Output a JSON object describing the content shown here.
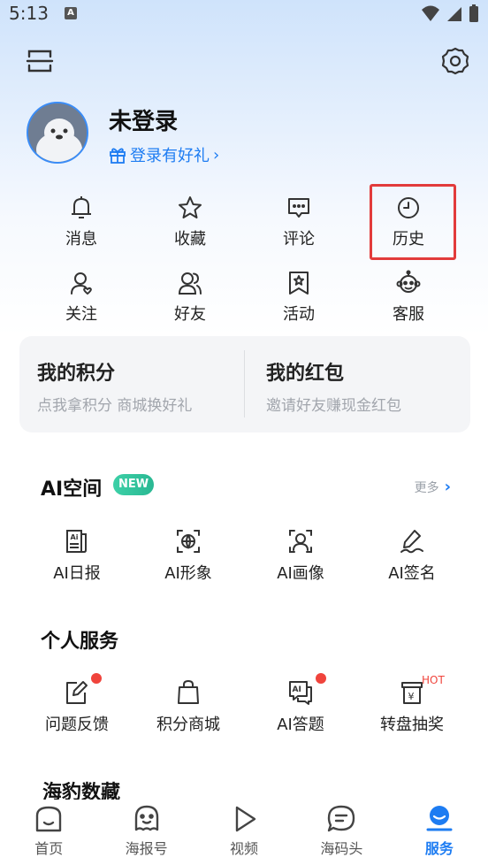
{
  "status_bar": {
    "time": "5:13",
    "a_icon": "A"
  },
  "profile": {
    "username": "未登录",
    "login_gift": "登录有好礼"
  },
  "quick_grid": [
    {
      "label": "消息",
      "icon": "bell-icon"
    },
    {
      "label": "收藏",
      "icon": "star-icon"
    },
    {
      "label": "评论",
      "icon": "comment-icon"
    },
    {
      "label": "历史",
      "icon": "clock-icon"
    },
    {
      "label": "关注",
      "icon": "follow-icon"
    },
    {
      "label": "好友",
      "icon": "friends-icon"
    },
    {
      "label": "活动",
      "icon": "activity-icon"
    },
    {
      "label": "客服",
      "icon": "service-icon"
    }
  ],
  "points_card": {
    "points_title": "我的积分",
    "points_sub": "点我拿积分 商城换好礼",
    "redpacket_title": "我的红包",
    "redpacket_sub": "邀请好友赚现金红包"
  },
  "ai_space": {
    "title": "AI空间",
    "badge": "NEW",
    "more": "更多",
    "items": [
      {
        "label": "AI日报",
        "icon": "ai-daily-icon"
      },
      {
        "label": "AI形象",
        "icon": "ai-avatar-icon"
      },
      {
        "label": "AI画像",
        "icon": "ai-portrait-icon"
      },
      {
        "label": "AI签名",
        "icon": "ai-signature-icon"
      }
    ]
  },
  "personal_services": {
    "title": "个人服务",
    "items": [
      {
        "label": "问题反馈",
        "icon": "feedback-icon"
      },
      {
        "label": "积分商城",
        "icon": "shopping-bag-icon"
      },
      {
        "label": "AI答题",
        "icon": "ai-quiz-icon"
      },
      {
        "label": "转盘抽奖",
        "icon": "lottery-icon"
      }
    ],
    "hot_label": "HOT"
  },
  "next_section": {
    "title": "海豹数藏"
  },
  "bottom_nav": [
    {
      "label": "首页",
      "icon": "home-icon"
    },
    {
      "label": "海报号",
      "icon": "poster-icon"
    },
    {
      "label": "视频",
      "icon": "play-icon"
    },
    {
      "label": "海码头",
      "icon": "chat-icon"
    },
    {
      "label": "服务",
      "icon": "service-face-icon"
    }
  ],
  "colors": {
    "accent": "#1d7cf2",
    "highlight": "#e23b3b",
    "badge": "#3cd0a7",
    "dot": "#f0443c"
  }
}
